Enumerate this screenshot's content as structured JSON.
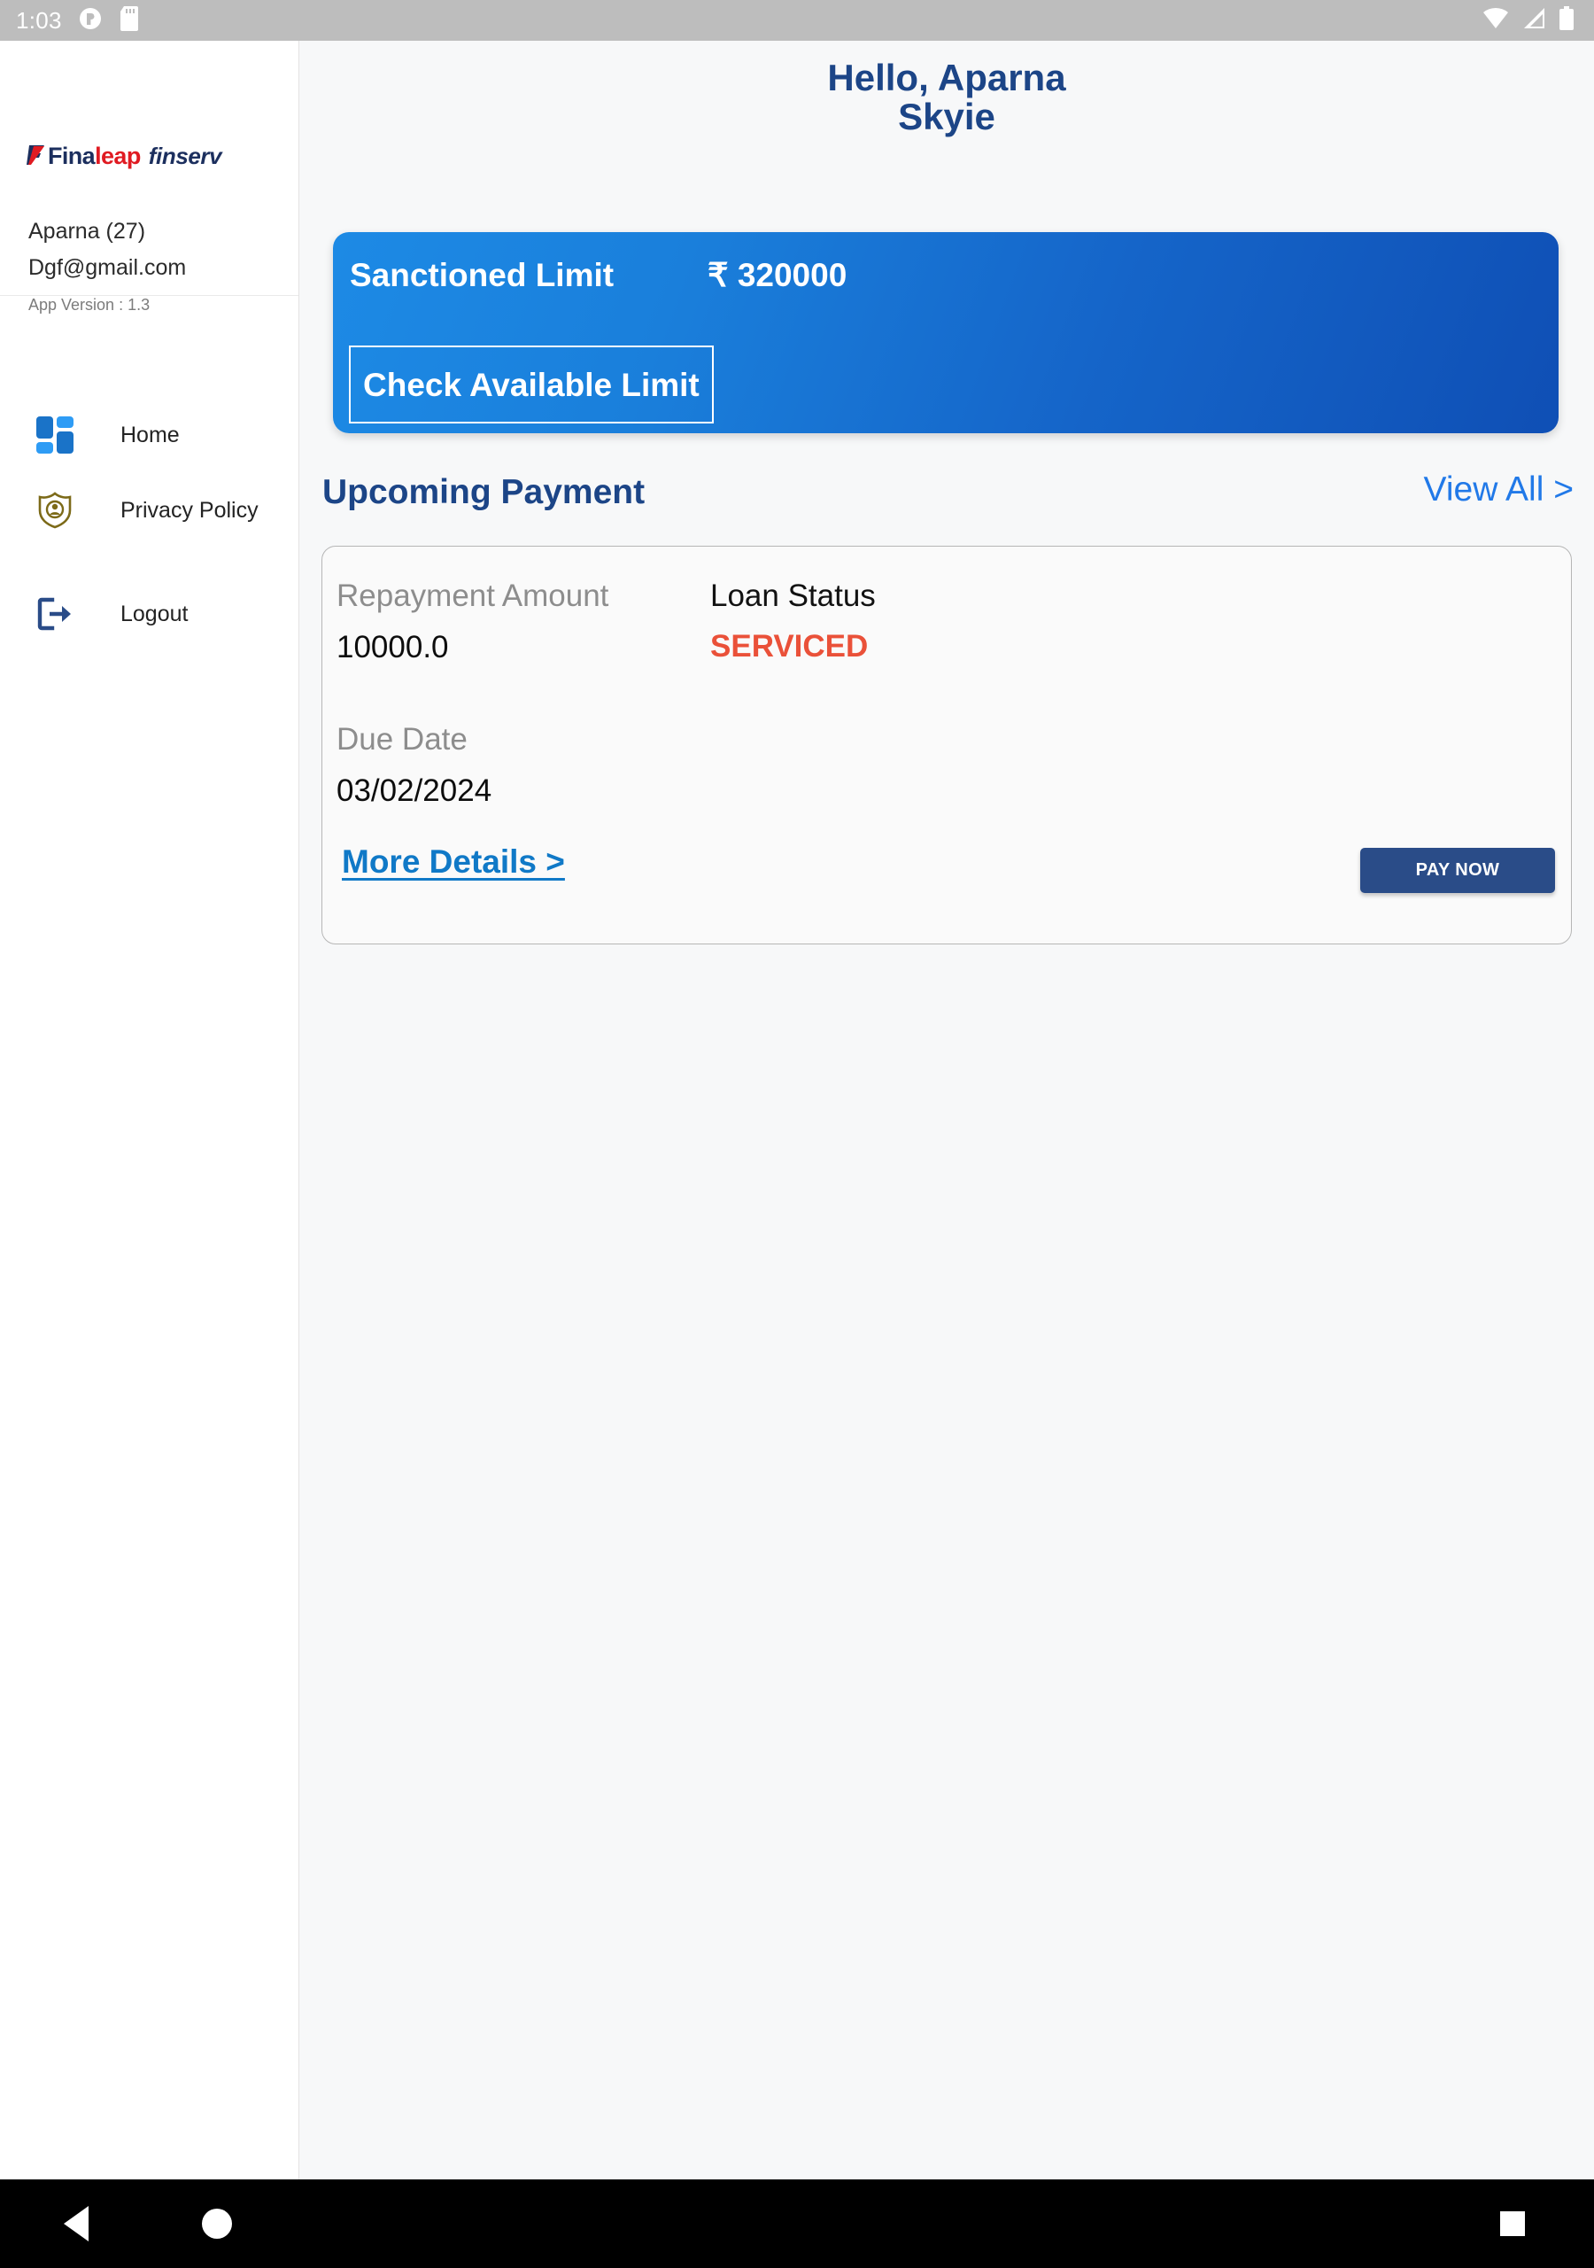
{
  "status_bar": {
    "time": "1:03",
    "icons": [
      "app-notification-icon",
      "sd-card-icon",
      "wifi-icon",
      "cellular-signal-icon",
      "battery-icon"
    ]
  },
  "sidebar": {
    "logo": {
      "mark": "finaleap-mark-icon",
      "part1": "Fina",
      "part2": "leap",
      "part3": "finserv"
    },
    "user_name": "Aparna (27)",
    "user_email": "Dgf@gmail.com",
    "app_version": "App Version : 1.3",
    "items": [
      {
        "label": "Home",
        "icon": "dashboard-grid-icon"
      },
      {
        "label": "Privacy Policy",
        "icon": "shield-person-icon"
      },
      {
        "label": "Logout",
        "icon": "logout-arrow-icon"
      }
    ]
  },
  "main": {
    "greeting_line1": "Hello, Aparna",
    "greeting_line2": "Skyie",
    "limit_card": {
      "label": "Sanctioned Limit",
      "value": "₹ 320000",
      "button_label": "Check Available Limit"
    },
    "upcoming_payment": {
      "heading": "Upcoming Payment",
      "view_all_label": "View All >",
      "card": {
        "repayment_label": "Repayment Amount",
        "repayment_value": "10000.0",
        "due_date_label": "Due Date",
        "due_date_value": "03/02/2024",
        "loan_status_label": "Loan Status",
        "loan_status_value": "SERVICED",
        "more_details_label": "More Details >",
        "pay_now_label": "PAY NOW"
      }
    }
  },
  "bottom_nav": {
    "back": "back-triangle-icon",
    "home": "home-circle-icon",
    "recents": "recents-square-icon"
  },
  "colors": {
    "brand_navy": "#1c4587",
    "brand_red": "#e01b22",
    "accent_blue": "#2179e8",
    "card_gradient_from": "#1d8ae5",
    "card_gradient_to": "#0f4fb5",
    "status_serviced": "#ea5139",
    "pay_now_bg": "#2a4c88",
    "link_blue": "#1079c7"
  }
}
